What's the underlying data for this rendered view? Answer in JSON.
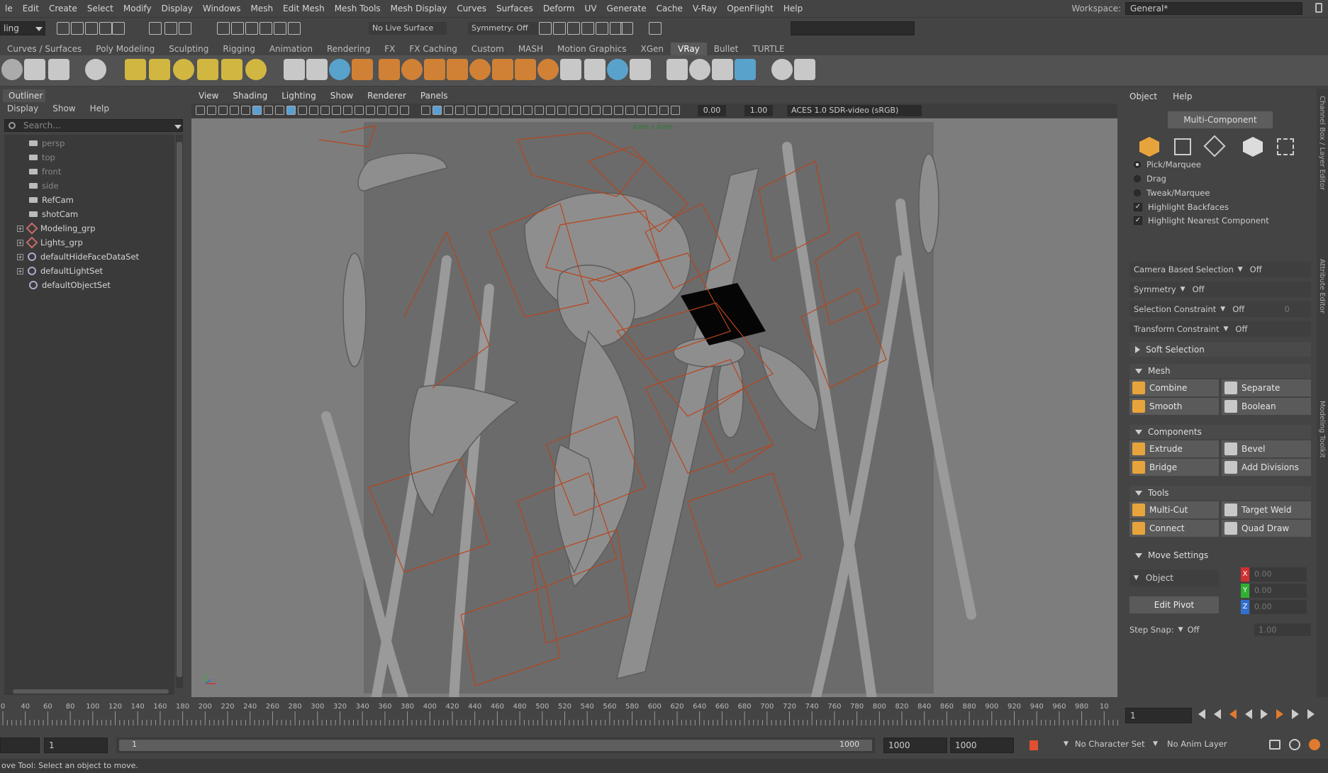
{
  "menubar": {
    "items": [
      "le",
      "Edit",
      "Create",
      "Select",
      "Modify",
      "Display",
      "Windows",
      "Mesh",
      "Edit Mesh",
      "Mesh Tools",
      "Mesh Display",
      "Curves",
      "Surfaces",
      "Deform",
      "UV",
      "Generate",
      "Cache",
      "V-Ray",
      "OpenFlight",
      "Help"
    ],
    "workspace_label": "Workspace:",
    "workspace_value": "General*"
  },
  "statusline": {
    "mode": "ling",
    "live_surface": "No Live Surface",
    "symmetry": "Symmetry: Off"
  },
  "shelf": {
    "tabs": [
      "Curves / Surfaces",
      "Poly Modeling",
      "Sculpting",
      "Rigging",
      "Animation",
      "Rendering",
      "FX",
      "FX Caching",
      "Custom",
      "MASH",
      "Motion Graphics",
      "XGen",
      "VRay",
      "Bullet",
      "TURTLE"
    ],
    "active_tab": "VRay"
  },
  "outliner": {
    "title": "Outliner",
    "menu": [
      "Display",
      "Show",
      "Help"
    ],
    "search_placeholder": "Search...",
    "items": [
      {
        "label": "persp",
        "kind": "camera",
        "dim": true,
        "expandable": false
      },
      {
        "label": "top",
        "kind": "camera",
        "dim": true,
        "expandable": false
      },
      {
        "label": "front",
        "kind": "camera",
        "dim": true,
        "expandable": false
      },
      {
        "label": "side",
        "kind": "camera",
        "dim": true,
        "expandable": false
      },
      {
        "label": "RefCam",
        "kind": "camera",
        "dim": false,
        "expandable": false
      },
      {
        "label": "shotCam",
        "kind": "camera",
        "dim": false,
        "expandable": false
      },
      {
        "label": "Modeling_grp",
        "kind": "group",
        "dim": false,
        "expandable": true
      },
      {
        "label": "Lights_grp",
        "kind": "group",
        "dim": false,
        "expandable": true
      },
      {
        "label": "defaultHideFaceDataSet",
        "kind": "set",
        "dim": false,
        "expandable": true
      },
      {
        "label": "defaultLightSet",
        "kind": "set",
        "dim": false,
        "expandable": true
      },
      {
        "label": "defaultObjectSet",
        "kind": "set",
        "dim": false,
        "expandable": false
      }
    ]
  },
  "viewport": {
    "menu": [
      "View",
      "Shading",
      "Lighting",
      "Show",
      "Renderer",
      "Panels"
    ],
    "exposure": "0.00",
    "gamma": "1.00",
    "color_space": "ACES 1.0 SDR-video (sRGB)",
    "resolution_label": "4096 x 4096"
  },
  "modeling_toolkit": {
    "menu": [
      "Object",
      "Help"
    ],
    "multi_component": "Multi-Component",
    "selection_modes": [
      "Pick/Marquee",
      "Drag",
      "Tweak/Marquee"
    ],
    "highlight_backfaces": "Highlight Backfaces",
    "highlight_nearest": "Highlight Nearest Component",
    "camera_based_selection": {
      "label": "Camera Based Selection",
      "value": "Off"
    },
    "symmetry": {
      "label": "Symmetry",
      "value": "Off"
    },
    "selection_constraint": {
      "label": "Selection Constraint",
      "value": "Off",
      "num": "0"
    },
    "transform_constraint": {
      "label": "Transform Constraint",
      "value": "Off"
    },
    "soft_selection": "Soft Selection",
    "mesh_section": "Mesh",
    "mesh_buttons": [
      "Combine",
      "Separate",
      "Smooth",
      "Boolean"
    ],
    "components_section": "Components",
    "component_buttons": [
      "Extrude",
      "Bevel",
      "Bridge",
      "Add Divisions"
    ],
    "tools_section": "Tools",
    "tool_buttons": [
      "Multi-Cut",
      "Target Weld",
      "Connect",
      "Quad Draw"
    ],
    "move_settings": "Move Settings",
    "move_space": "Object",
    "edit_pivot": "Edit Pivot",
    "xyz": {
      "x": "0.00",
      "y": "0.00",
      "z": "0.00"
    },
    "axis_labels": [
      "X",
      "Y",
      "Z"
    ],
    "step_snap": {
      "label": "Step Snap:",
      "value": "Off",
      "num": "1.00"
    }
  },
  "side_tabs": [
    "Channel Box / Layer Editor",
    "Attribute Editor",
    "Modeling Toolkit"
  ],
  "timeline": {
    "ticks": [
      "0",
      "40",
      "60",
      "80",
      "100",
      "120",
      "140",
      "160",
      "180",
      "200",
      "220",
      "240",
      "260",
      "280",
      "300",
      "320",
      "340",
      "360",
      "380",
      "400",
      "420",
      "440",
      "460",
      "480",
      "500",
      "520",
      "540",
      "560",
      "580",
      "600",
      "620",
      "640",
      "660",
      "680",
      "700",
      "720",
      "740",
      "760",
      "780",
      "800",
      "820",
      "840",
      "860",
      "880",
      "900",
      "920",
      "940",
      "960",
      "980",
      "10"
    ],
    "current_frame": "1"
  },
  "range": {
    "start": "1",
    "range_start": "1",
    "range_end": "1000",
    "end1": "1000",
    "end2": "1000",
    "character_set": "No Character Set",
    "anim_layer": "No Anim Layer"
  },
  "help_line": "ove Tool: Select an object to move.",
  "colors": {
    "accent": "#5a9fd4",
    "wire": "#c04018",
    "x": "#d03030",
    "y": "#30b030",
    "z": "#3070d0"
  }
}
